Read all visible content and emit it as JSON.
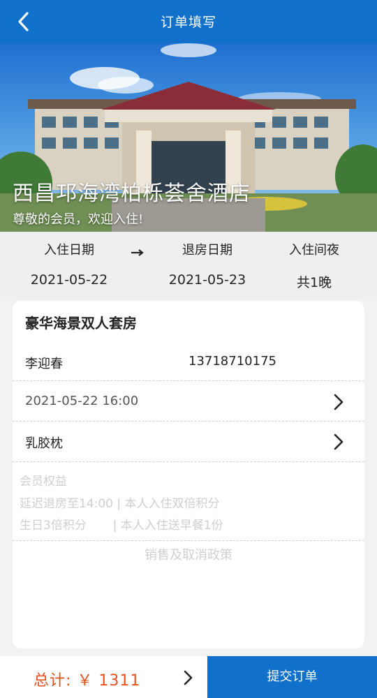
{
  "header": {
    "title": "订单填写",
    "back_icon": "chevron-left-icon"
  },
  "hotel": {
    "name": "西昌邛海湾柏栎荟舍酒店",
    "welcome": "尊敬的会员，欢迎入住!"
  },
  "dates": {
    "checkin_label": "入住日期",
    "checkout_label": "退房日期",
    "nights_label": "入住间夜",
    "checkin_value": "2021-05-22",
    "checkout_value": "2021-05-23",
    "nights_value": "共1晚"
  },
  "room": {
    "title": "豪华海景双人套房",
    "guest_name": "李迎春",
    "guest_phone": "13718710175",
    "arrival_time": "2021-05-22 16:00",
    "pillow": "乳胶枕"
  },
  "benefits": {
    "title": "会员权益",
    "line1": "延迟退房至14:00 | 本人入住双倍积分",
    "line2": "生日3倍积分       | 本人入住送早餐1份"
  },
  "policy": "销售及取消政策",
  "footer": {
    "total": "总计: ￥ 1311",
    "submit_label": "提交订单"
  },
  "colors": {
    "primary": "#1170c9",
    "price": "#e9501d"
  }
}
